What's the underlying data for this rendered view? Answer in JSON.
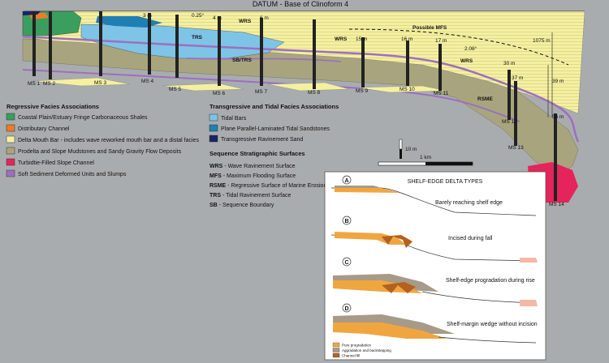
{
  "datum": {
    "label": "DATUM - Base of Clinoform 4"
  },
  "cross_section": {
    "surface_labels": {
      "wrs_1": "WRS",
      "trs": "TRS",
      "sb_trs": "SB/TRS",
      "mfs": "Possible MFS",
      "wrs_2": "WRS",
      "wrs_3": "WRS",
      "rsme": "RSME"
    },
    "distance_labels": [
      "3 m",
      "0.25°",
      "4 m",
      "6 m",
      "15 m",
      "16 m",
      "17 m",
      "1075 m",
      "30 m",
      "37 m",
      "39 m",
      "2.08°",
      "56 m"
    ],
    "sections": [
      "MS 1",
      "MS 2",
      "MS 3",
      "MS 4",
      "MS 5",
      "MS 6",
      "MS 7",
      "MS 8",
      "MS 9",
      "MS 10",
      "MS 11",
      "MS 12",
      "MS 13",
      "MS 14"
    ],
    "scale": {
      "vertical": "10 m",
      "horizontal": "1 km"
    }
  },
  "legend": {
    "regressive": {
      "title": "Regressive Facies Associations",
      "items": [
        {
          "label": "Coastal Plain/Estuary Fringe Carbonaceous Shales",
          "color": "#3a9e5f"
        },
        {
          "label": "Distributary Channel",
          "color": "#ee7b28"
        },
        {
          "label": "Delta Mouth Bar - includes wave reworked mouth bar and a distal facies",
          "color": "#f5f0a0"
        },
        {
          "label": "Prodelta and Slope Mudstones and Sandy Gravity Flow Deposits",
          "color": "#a8a57e"
        },
        {
          "label": "Turbidtie-Filled Slope Channel",
          "color": "#e4245a"
        },
        {
          "label": "Soft Sediment Deformed Units and Slumps",
          "color": "#9c6fc2"
        }
      ]
    },
    "transgressive": {
      "title": "Transgressive and Tidal Facies Associations",
      "items": [
        {
          "label": "Tidal Bars",
          "color": "#7ec4e6"
        },
        {
          "label": "Plane Parallel-Laminated Tidal Sandstones",
          "color": "#1f7fb3"
        },
        {
          "label": "Transgressive Ravinement Sand",
          "color": "#1a2366"
        }
      ]
    },
    "surfaces": {
      "title": "Sequence Stratigraphic Surfaces",
      "items": [
        {
          "abbr": "WRS",
          "text": " - Wave Ravinement Surface"
        },
        {
          "abbr": "MFS",
          "text": " - Maximum Flooding Surface"
        },
        {
          "abbr": "RSME",
          "text": " - Regressive Surface of Marine Erosion"
        },
        {
          "abbr": "TRS",
          "text": " - Tidal Ravinement Surface"
        },
        {
          "abbr": "SB",
          "text": " - Sequence Boundary"
        }
      ]
    }
  },
  "inset": {
    "title": "SHELF-EDGE DELTA TYPES",
    "panels": [
      {
        "letter": "A",
        "caption": "Barely reaching shelf edge"
      },
      {
        "letter": "B",
        "caption": "Incised during  fall"
      },
      {
        "letter": "C",
        "caption": "Shelf-edge progradation during rise"
      },
      {
        "letter": "D",
        "caption": "Shelf-margin wedge without incision"
      }
    ],
    "key": [
      {
        "label": "Pure progradation",
        "color": "#f0a640"
      },
      {
        "label": "Aggradation and backstepping",
        "color": "#a89a88"
      },
      {
        "label": "Channel fill",
        "color": "#b5611d"
      }
    ]
  }
}
